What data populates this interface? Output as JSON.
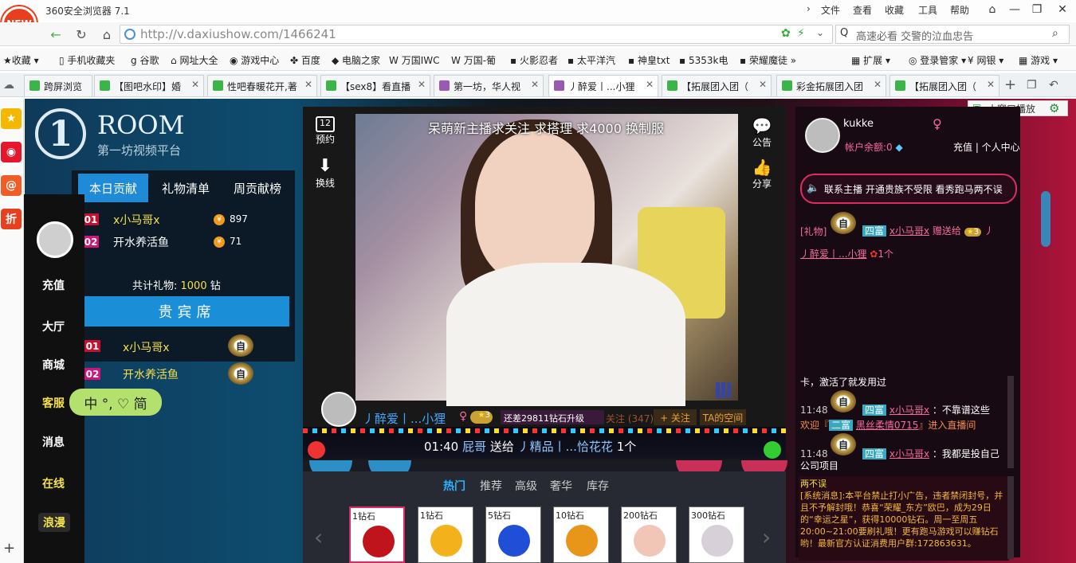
{
  "browser": {
    "logo_text": "NEW",
    "title": "360安全浏览器 7.1",
    "menu": [
      "文件",
      "查看",
      "收藏",
      "工具",
      "帮助"
    ],
    "url": "http://v.daxiushow.com/1466241",
    "search_placeholder": "高速必看 交警的泣血忠告",
    "bookmarks": [
      "收藏",
      "手机收藏夹",
      "谷歌",
      "网址大全",
      "游戏中心",
      "百度",
      "电脑之家",
      "万国IWC",
      "万国-葡",
      "火影忍者",
      "太平洋汽",
      "神皇txt",
      "5353k电",
      "荣耀魔徒",
      "扩展",
      "登录管家",
      "网银",
      "游戏"
    ],
    "tabs": [
      "跨屏浏览",
      "【图吧水印】婚",
      "性吧春暖花开,著",
      "【sex8】看直播",
      "第一坊，华人视",
      "丿醉爱丨...小狸",
      "【拓展团入团（",
      "彩金拓展团入团",
      "【拓展团入团（"
    ],
    "small_window": "小窗口播放"
  },
  "room": {
    "logo_letter": "1",
    "title": "ROOM",
    "subtitle": "第一坊视频平台"
  },
  "contrib": {
    "tabs": [
      "本日贡献",
      "礼物清单",
      "周贡献榜"
    ],
    "rows": [
      {
        "no": "01",
        "name": "x小马哥x",
        "value": "897"
      },
      {
        "no": "02",
        "name": "开水养活鱼",
        "value": "71"
      }
    ],
    "total_label": "共计礼物: ",
    "total_value": "1000",
    "total_unit": " 钻"
  },
  "vip": {
    "title": "贵宾席",
    "rows": [
      {
        "no": "01",
        "name": "x小马哥x"
      },
      {
        "no": "02",
        "name": "开水养活鱼"
      }
    ],
    "badge": "自"
  },
  "left_menu": [
    "充值",
    "大厅",
    "商城",
    "客服",
    "消息",
    "在线",
    "浪漫"
  ],
  "ime": "中 °, ♡ 简",
  "video": {
    "caption": "呆萌新主播求关注 求搭理 求4000 换制服",
    "left_controls": [
      {
        "icon": "12",
        "label": "预约"
      },
      {
        "icon": "⬇",
        "label": "换线"
      }
    ],
    "right_controls": [
      {
        "icon": "💬",
        "label": "公告"
      },
      {
        "icon": "👍",
        "label": "分享"
      }
    ],
    "host_name": "丿醉爱丨...小狸",
    "host_level": "3",
    "upgrade_text": "还差29811钻石升级",
    "follow_count": "关注 (347)",
    "follow_btn": "+ 关注",
    "space_btn": "TA的空间",
    "marquee": {
      "time": "01:40",
      "from": "屁哥",
      "action": "送给",
      "to": "丿精品丨...恰花花",
      "count": "1个"
    }
  },
  "gifts": {
    "tabs": [
      "热门",
      "推荐",
      "高级",
      "奢华",
      "库存"
    ],
    "items": [
      {
        "label": "1钻石",
        "color": "#c0141c"
      },
      {
        "label": "1钻石",
        "color": "#f3b21c"
      },
      {
        "label": "5钻石",
        "color": "#1f4fd6"
      },
      {
        "label": "10钻石",
        "color": "#e8961a"
      },
      {
        "label": "200钻石",
        "color": "#f2c6b6"
      },
      {
        "label": "300钻石",
        "color": "#d8d0d8"
      }
    ]
  },
  "user": {
    "name": "kukke",
    "balance": "帐户余额:0",
    "links": "充值 | 个人中心",
    "notice": "联系主播  开通贵族不受限  看秀跑马两不误"
  },
  "chat": {
    "gift_line": {
      "tag": "[礼物]",
      "rank": "四富",
      "from": "x小马哥x",
      "action": "赠送给",
      "level": "3",
      "to": "丿醉爱丨...小狸",
      "count": "1个"
    },
    "line1": "卡，激活了就发用过",
    "line2": {
      "time": "11:48",
      "rank": "四富",
      "user": "x小马哥x",
      "text": "：不靠谱这些"
    },
    "line3": {
      "prefix": "欢迎『",
      "rank": "二富",
      "user": "黑丝柔情0715",
      "suffix": "』进入直播间"
    },
    "line4": {
      "time": "11:48",
      "rank": "四富",
      "user": "x小马哥x",
      "text": "：我都是投自己"
    },
    "line5": "公司项目"
  },
  "system": {
    "title": "两不误",
    "text": "[系统消息]:本平台禁止打小广告，违者禁闭封号，并且不予解封哦！恭喜“荣耀_东方”欧巴，成为29日的“幸运之星”，获得10000钻石。周一至周五20:00~21:00要刷礼哦！更有跑马游戏可以赚钻石哟！最新官方认证消费用户群:172863631。"
  }
}
